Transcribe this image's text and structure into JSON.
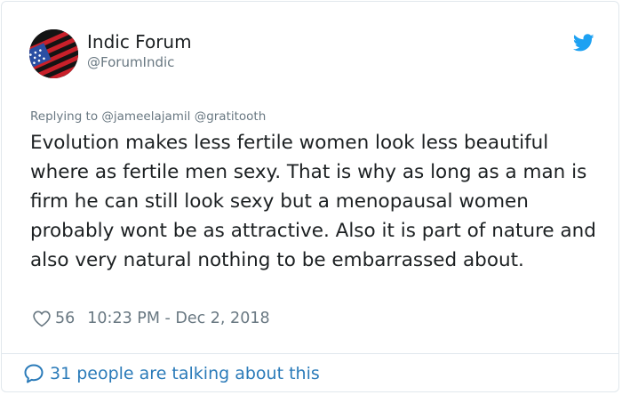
{
  "author": {
    "name": "Indic Forum",
    "handle": "@ForumIndic"
  },
  "reply": {
    "prefix": "Replying to",
    "mentions": [
      "@jameelajamil",
      "@gratitooth"
    ]
  },
  "tweet": {
    "text": "Evolution makes less fertile women look less beautiful where as fertile men sexy. That is why as long as a man is firm he can still look sexy but a menopausal women probably wont be as attractive. Also it is part of nature and also very natural nothing to be embarrassed about."
  },
  "meta": {
    "likes": "56",
    "timestamp": "10:23 PM - Dec 2, 2018"
  },
  "footer": {
    "talking": "31 people are talking about this"
  },
  "icons": {
    "brand": "twitter-bird-icon",
    "like": "heart-icon",
    "conversation": "speech-bubble-icon"
  },
  "colors": {
    "brand_blue": "#1da1f2",
    "link_blue": "#2b7bb9",
    "muted_text": "#697882",
    "body_text": "#1c2022",
    "border": "#e1e8ed"
  }
}
